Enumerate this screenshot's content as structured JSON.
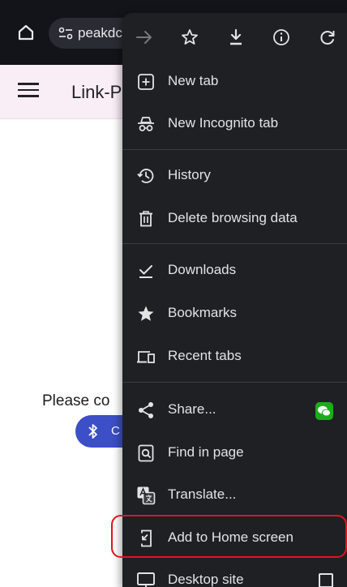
{
  "browser": {
    "url_text": "peakdc"
  },
  "page": {
    "title": "Link-P",
    "message": "Please co",
    "connect_label": "C"
  },
  "menu": {
    "top_icons": [
      "forward-arrow-icon",
      "star-icon",
      "download-icon",
      "info-icon",
      "refresh-icon"
    ],
    "items": [
      {
        "label": "New tab",
        "icon": "new-tab-icon"
      },
      {
        "label": "New Incognito tab",
        "icon": "incognito-icon"
      },
      {
        "label": "History",
        "icon": "history-icon"
      },
      {
        "label": "Delete browsing data",
        "icon": "trash-icon"
      },
      {
        "label": "Downloads",
        "icon": "downloads-check-icon"
      },
      {
        "label": "Bookmarks",
        "icon": "bookmark-star-icon"
      },
      {
        "label": "Recent tabs",
        "icon": "recent-tabs-icon"
      },
      {
        "label": "Share...",
        "icon": "share-icon"
      },
      {
        "label": "Find in page",
        "icon": "find-in-page-icon"
      },
      {
        "label": "Translate...",
        "icon": "translate-icon"
      },
      {
        "label": "Add to Home screen",
        "icon": "add-to-home-icon"
      },
      {
        "label": "Desktop site",
        "icon": "desktop-icon"
      }
    ]
  },
  "colors": {
    "menu_bg": "#1f2024",
    "highlight": "#e0141e",
    "accent_button": "#3c4fc6",
    "wechat": "#1aad19"
  }
}
